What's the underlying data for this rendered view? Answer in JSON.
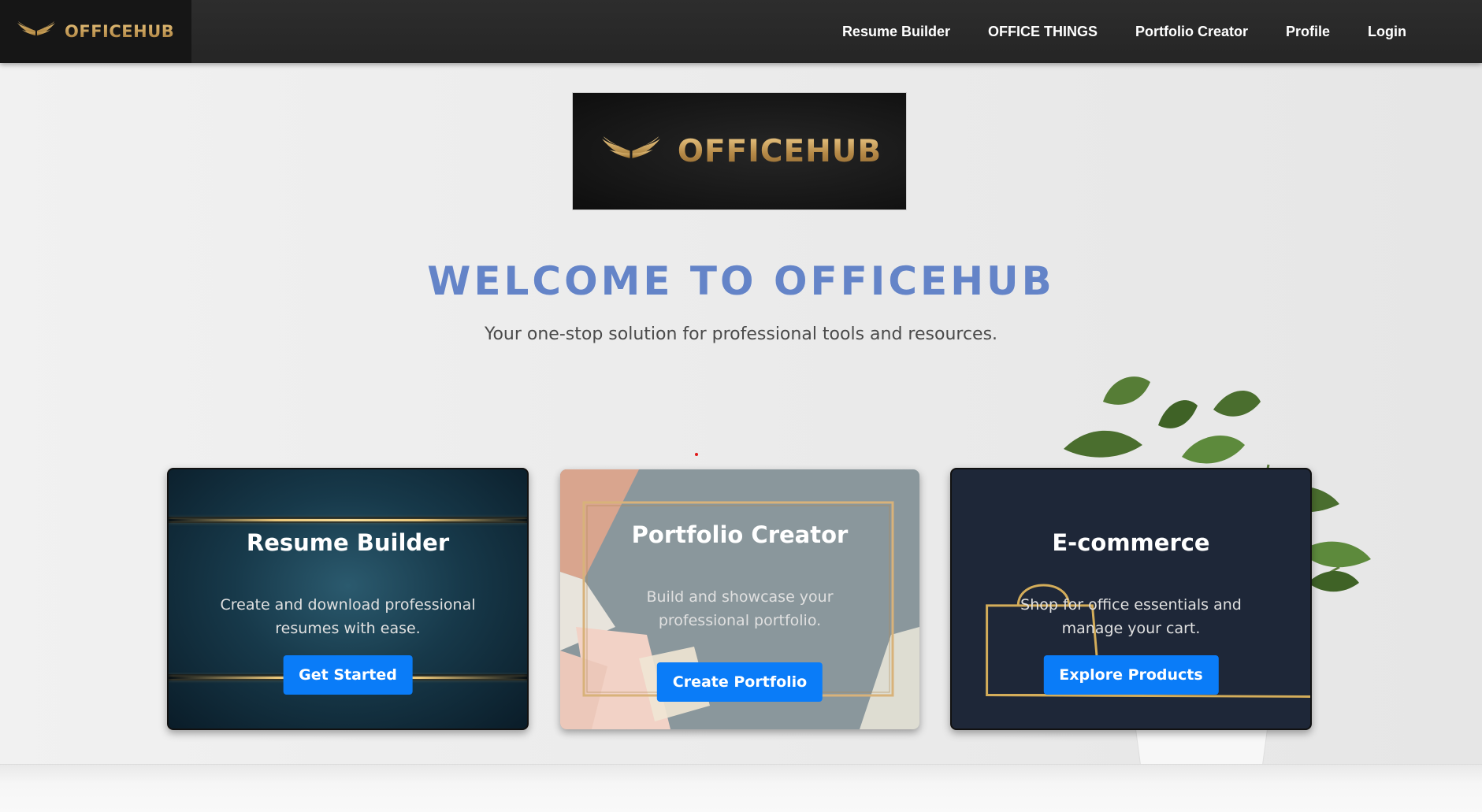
{
  "navbar": {
    "brand": "OFFICEHUB",
    "links": [
      "Resume Builder",
      "OFFICE THINGS",
      "Portfolio Creator",
      "Profile",
      "Login"
    ]
  },
  "hero": {
    "logo_text": "OFFICEHUB",
    "title": "WELCOME TO OFFICEHUB",
    "subtitle": "Your one-stop solution for professional tools and resources."
  },
  "cards": [
    {
      "title": "Resume Builder",
      "description": "Create and download professional resumes with ease.",
      "button": "Get Started"
    },
    {
      "title": "Portfolio Creator",
      "description": "Build and showcase your professional portfolio.",
      "button": "Create Portfolio"
    },
    {
      "title": "E-commerce",
      "description": "Shop for office essentials and manage your cart.",
      "button": "Explore Products"
    }
  ],
  "colors": {
    "accent_blue": "#0a7cf8",
    "title_blue": "#6484c8",
    "gold": "#c9a15a",
    "navbar": "#2a2a2a"
  },
  "icons": {
    "brand_icon": "wings-icon",
    "hero_icon": "wings-icon",
    "card3_icon": "shopping-bag-icon"
  }
}
